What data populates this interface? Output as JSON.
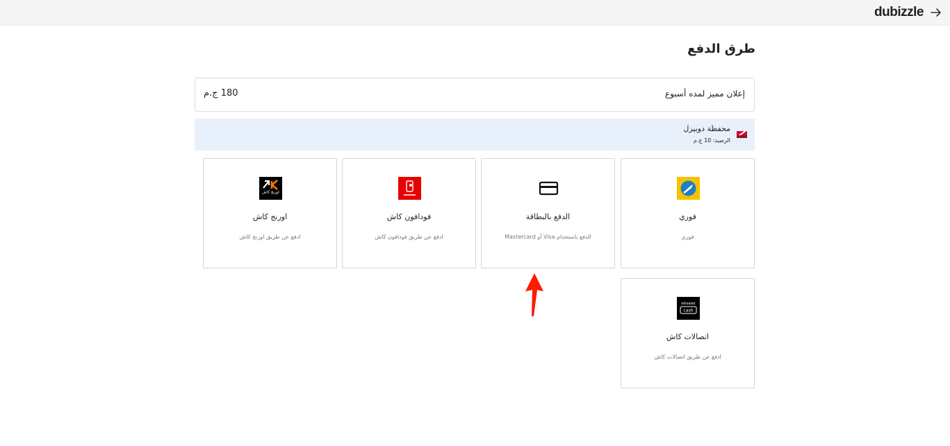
{
  "header": {
    "brand": "dubizzle",
    "back_icon": "arrow-right-icon"
  },
  "page": {
    "title": "طرق الدفع"
  },
  "summary": {
    "item_label": "إعلان مميز لمده أسبوع",
    "amount": "180 ج.م"
  },
  "wallet": {
    "title": "محفظة دوبيزل",
    "balance": "الرصيد: 10 ج.م",
    "icon": "wallet-icon"
  },
  "payment_methods": [
    {
      "name": "فوري",
      "description": "فوري",
      "icon": "fawry-icon"
    },
    {
      "name": "الدفع بالبطاقة",
      "description": "الدفع باستخدام Visa أو Mastercard",
      "icon": "credit-card-icon"
    },
    {
      "name": "فودافون كاش",
      "description": "ادفع عن طريق فودافون كاش",
      "icon": "vodafone-cash-icon"
    },
    {
      "name": "اورنج كاش",
      "description": "ادفع عن طريق اورنج كاش",
      "icon": "orange-cash-icon"
    },
    {
      "name": "اتصالات كاش",
      "description": "ادفع عن طريق اتصالات كاش",
      "icon": "etisalat-cash-icon"
    }
  ],
  "logo_text": {
    "orange_cash": "اورنج كاش",
    "etisalat_top": "etisalat",
    "etisalat_bottom": "cash"
  },
  "colors": {
    "fawry": "#f6c200",
    "vodafone": "#e60000",
    "orange_cash_bg": "#000000",
    "orange_accent": "#ff7900",
    "wallet_bg": "#e7f0fb",
    "arrow": "#ff1a00"
  }
}
